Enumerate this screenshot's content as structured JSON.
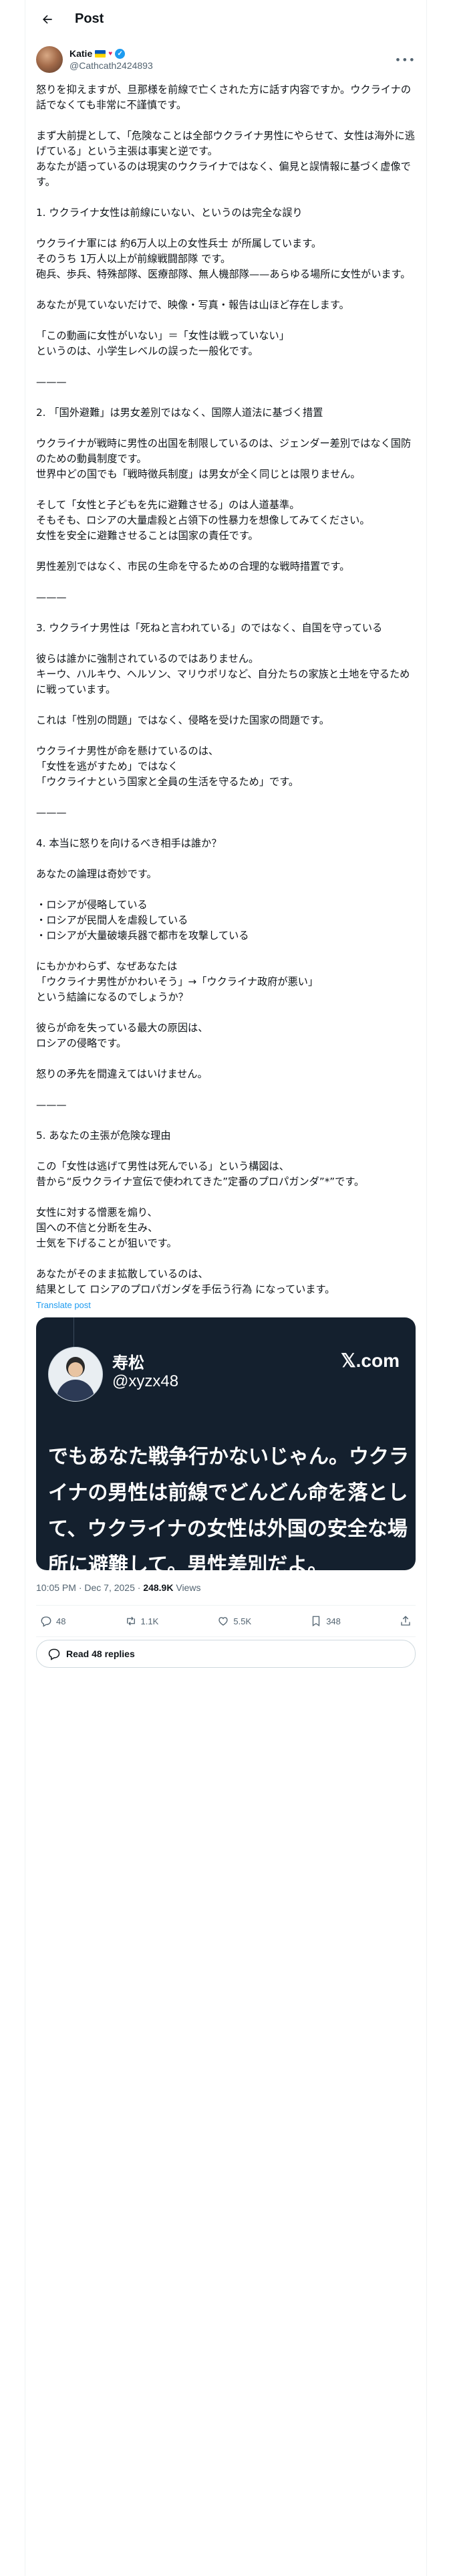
{
  "header": {
    "title": "Post"
  },
  "author": {
    "name": "Katie",
    "handle": "@Cathcath2424893",
    "heart": "♥"
  },
  "post": {
    "body": "怒りを抑えますが、旦那様を前線で亡くされた方に話す内容ですか。ウクライナの話でなくても非常に不謹慎です。\n\nまず大前提として、「危険なことは全部ウクライナ男性にやらせて、女性は海外に逃げている」という主張は事実と逆です。\nあなたが語っているのは現実のウクライナではなく、偏見と誤情報に基づく虚像です。\n\n1. ウクライナ女性は前線にいない、というのは完全な誤り\n\nウクライナ軍には 約6万人以上の女性兵士 が所属しています。\nそのうち 1万人以上が前線戦闘部隊 です。\n砲兵、歩兵、特殊部隊、医療部隊、無人機部隊——あらゆる場所に女性がいます。\n\nあなたが見ていないだけで、映像・写真・報告は山ほど存在します。\n\n「この動画に女性がいない」＝「女性は戦っていない」\nというのは、小学生レベルの誤った一般化です。\n\n———\n\n2. 「国外避難」は男女差別ではなく、国際人道法に基づく措置\n\nウクライナが戦時に男性の出国を制限しているのは、ジェンダー差別ではなく国防のための動員制度です。\n世界中どの国でも「戦時徴兵制度」は男女が全く同じとは限りません。\n\nそして「女性と子どもを先に避難させる」のは人道基準。\nそもそも、ロシアの大量虐殺と占領下の性暴力を想像してみてください。\n女性を安全に避難させることは国家の責任です。\n\n男性差別ではなく、市民の生命を守るための合理的な戦時措置です。\n\n———\n\n3. ウクライナ男性は「死ねと言われている」のではなく、自国を守っている\n\n彼らは誰かに強制されているのではありません。\nキーウ、ハルキウ、ヘルソン、マリウポリなど、自分たちの家族と土地を守るために戦っています。\n\nこれは「性別の問題」ではなく、侵略を受けた国家の問題です。\n\nウクライナ男性が命を懸けているのは、\n「女性を逃がすため」ではなく\n「ウクライナという国家と全員の生活を守るため」です。\n\n———\n\n4. 本当に怒りを向けるべき相手は誰か？\n\nあなたの論理は奇妙です。\n\n・ロシアが侵略している\n・ロシアが民間人を虐殺している\n・ロシアが大量破壊兵器で都市を攻撃している\n\nにもかかわらず、なぜあなたは\n「ウクライナ男性がかわいそう」→「ウクライナ政府が悪い」\nという結論になるのでしょうか？\n\n彼らが命を失っている最大の原因は、\nロシアの侵略です。\n\n怒りの矛先を間違えてはいけません。\n\n———\n\n5. あなたの主張が危険な理由\n\nこの「女性は逃げて男性は死んでいる」という構図は、\n昔から“反ウクライナ宣伝で使われてきた”定番のプロパガンダ”*”です。\n\n女性に対する憎悪を煽り、\n国への不信と分断を生み、\n士気を下げることが狙いです。\n\nあなたがそのまま拡散しているのは、\n結果として ロシアのプロパガンダを手伝う行為 になっています。",
    "translate_label": "Translate post",
    "timestamp": "10:05 PM · Dec 7, 2025 · ",
    "views_count": "248.9K",
    "views_label": " Views"
  },
  "quoted_card": {
    "name": "寿松",
    "handle": "@xyzx48",
    "brand": "𝕏.com",
    "text": "でもあなた戦争行かないじゃん。ウクライナの男性は前線でどんどん命を落として、ウクライナの女性は外国の安全な場所に避難して。男性差別だよ。"
  },
  "actions": {
    "replies": "48",
    "reposts": "1.1K",
    "likes": "5.5K",
    "bookmarks": "348"
  },
  "read_replies": {
    "label": "Read 48 replies"
  },
  "icons": [
    "back-arrow-icon",
    "verified-icon",
    "more-icon",
    "reply-icon",
    "repost-icon",
    "like-icon",
    "bookmark-icon",
    "share-icon",
    "speech-bubble-icon"
  ]
}
